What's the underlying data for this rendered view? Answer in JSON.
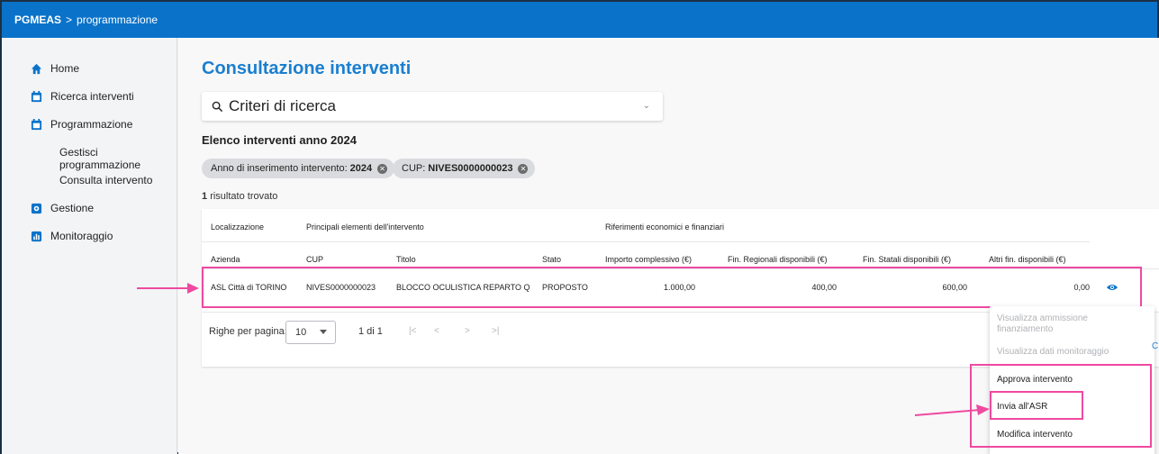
{
  "breadcrumb": {
    "app": "PGMEAS",
    "separator": ">",
    "section": "programmazione"
  },
  "sidebar": {
    "items": [
      {
        "label": "Home"
      },
      {
        "label": "Ricerca interventi"
      },
      {
        "label": "Programmazione"
      },
      {
        "label": "Gestisci programmazione"
      },
      {
        "label": "Consulta intervento"
      },
      {
        "label": "Gestione"
      },
      {
        "label": "Monitoraggio"
      }
    ]
  },
  "main": {
    "title": "Consultazione interventi",
    "search": {
      "label": "Criteri di ricerca"
    },
    "list_title": "Elenco interventi anno 2024",
    "filters": [
      {
        "label": "Anno di inserimento intervento:",
        "value": "2024"
      },
      {
        "label": "CUP:",
        "value": "NIVES0000000023"
      }
    ],
    "results": {
      "count": "1",
      "text": "risultato trovato"
    }
  },
  "table": {
    "groups": [
      "Localizzazione",
      "Principali elementi dell'intervento",
      "Riferimenti economici e finanziari"
    ],
    "columns": [
      "Azienda",
      "CUP",
      "Titolo",
      "Stato",
      "Importo complessivo (€)",
      "Fin. Regionali disponibili (€)",
      "Fin. Statali disponibili (€)",
      "Altri fin. disponibili (€)"
    ],
    "rows": [
      {
        "azienda": "ASL Città di TORINO",
        "cup": "NIVES0000000023",
        "titolo": "BLOCCO OCULISTICA REPARTO Q",
        "stato": "PROPOSTO",
        "importo": "1.000,00",
        "fin_regionali": "400,00",
        "fin_statali": "600,00",
        "altri_fin": "0,00"
      }
    ]
  },
  "pagination": {
    "rows_label": "Righe per pagina:",
    "rows_value": "10",
    "range": "1 di 1",
    "arrows": [
      "|<",
      "<",
      ">",
      ">|"
    ]
  },
  "menu": {
    "items": [
      {
        "label": "Visualizza ammissione finanziamento",
        "disabled": true
      },
      {
        "label": "Visualizza dati monitoraggio",
        "disabled": true
      },
      {
        "label": "Approva intervento",
        "disabled": false
      },
      {
        "label": "Invia all'ASR",
        "disabled": false
      },
      {
        "label": "Modifica intervento",
        "disabled": false
      }
    ]
  },
  "clipped_text": "C",
  "colors": {
    "brand": "#0a73c9",
    "title": "#1b7fcf",
    "annotation": "#ee4aa0"
  },
  "icons": [
    "home-icon",
    "calendar-icon",
    "gear-icon",
    "chart-icon",
    "search-icon",
    "eye-icon",
    "arrow-icon"
  ]
}
